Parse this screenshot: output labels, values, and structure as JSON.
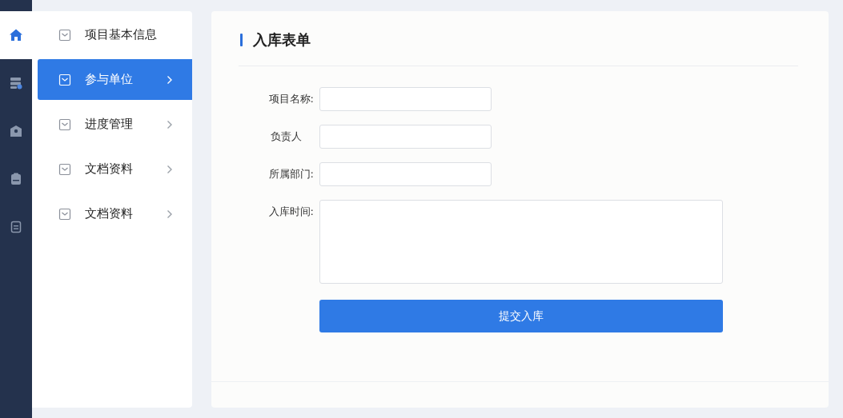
{
  "rail": [
    {
      "selected": true
    },
    {
      "selected": false
    },
    {
      "selected": false
    },
    {
      "selected": false
    },
    {
      "selected": false
    }
  ],
  "menu": [
    {
      "label": "项目基本信息",
      "selected": false,
      "arrow": false
    },
    {
      "label": "参与单位",
      "selected": true,
      "arrow": true
    },
    {
      "label": "进度管理",
      "selected": false,
      "arrow": true
    },
    {
      "label": "文档资料",
      "selected": false,
      "arrow": true
    },
    {
      "label": "文档资料",
      "selected": false,
      "arrow": true
    }
  ],
  "form": {
    "title": "入库表单",
    "fields": [
      {
        "label": "项目名称:",
        "kind": "input"
      },
      {
        "label": "负责人",
        "kind": "input"
      },
      {
        "label": "所属部门:",
        "kind": "input"
      },
      {
        "label": "入库时间:",
        "kind": "textarea"
      }
    ],
    "submit": "提交入库"
  }
}
